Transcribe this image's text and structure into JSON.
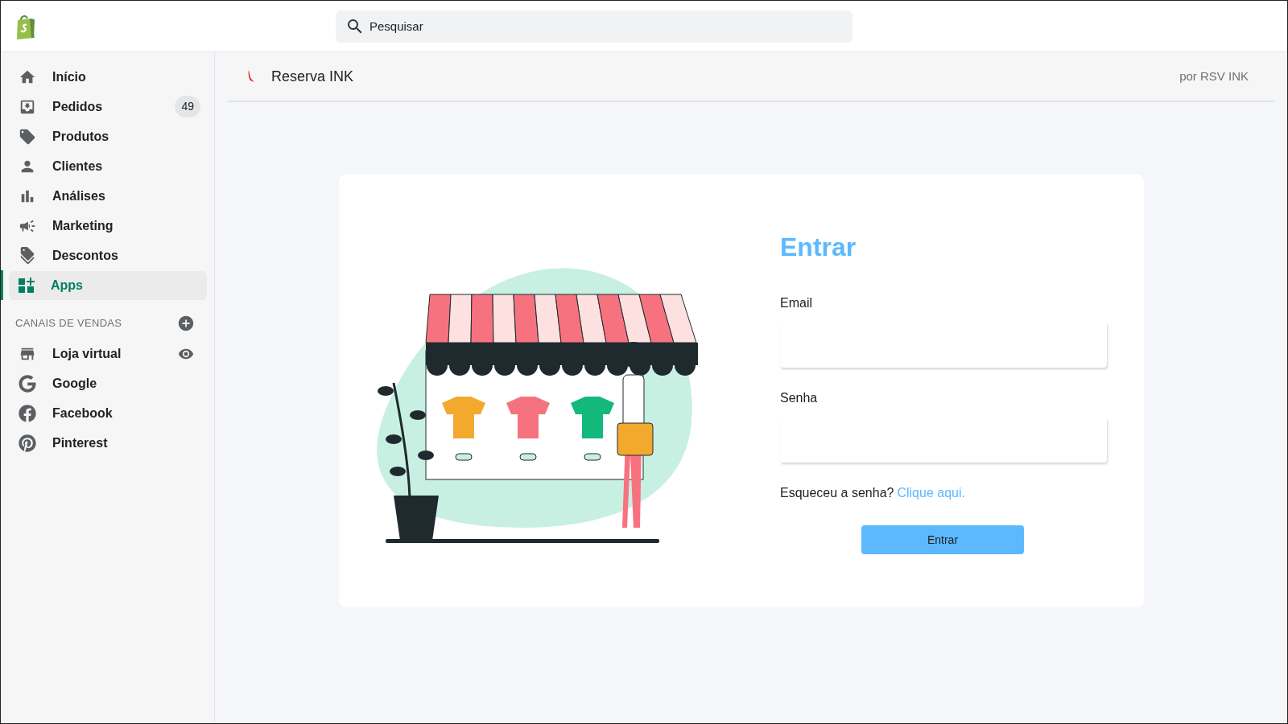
{
  "search": {
    "placeholder": "Pesquisar"
  },
  "sidebar": {
    "items": [
      {
        "label": "Início",
        "selected": false
      },
      {
        "label": "Pedidos",
        "selected": false,
        "badge": "49"
      },
      {
        "label": "Produtos",
        "selected": false
      },
      {
        "label": "Clientes",
        "selected": false
      },
      {
        "label": "Análises",
        "selected": false
      },
      {
        "label": "Marketing",
        "selected": false
      },
      {
        "label": "Descontos",
        "selected": false
      },
      {
        "label": "Apps",
        "selected": true
      }
    ],
    "section_title": "CANAIS DE VENDAS",
    "channels": [
      {
        "label": "Loja virtual"
      },
      {
        "label": "Google"
      },
      {
        "label": "Facebook"
      },
      {
        "label": "Pinterest"
      }
    ]
  },
  "app_header": {
    "title": "Reserva INK",
    "byline": "por RSV INK"
  },
  "login": {
    "title": "Entrar",
    "email_label": "Email",
    "password_label": "Senha",
    "forgot_text": "Esqueceu a senha?",
    "forgot_link": "Clique aqui.",
    "button": "Entrar"
  }
}
